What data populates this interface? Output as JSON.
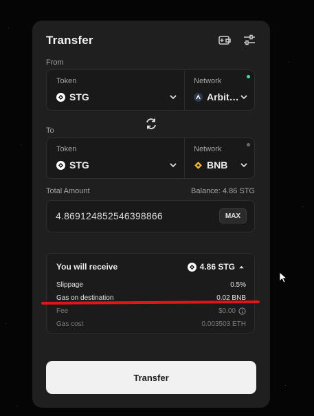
{
  "header": {
    "title": "Transfer",
    "icons": [
      "add-wallet-icon",
      "settings-sliders-icon"
    ]
  },
  "from": {
    "label": "From",
    "token_caption": "Token",
    "token": "STG",
    "network_caption": "Network",
    "network": "Arbit…",
    "status_color": "#4fd1b5"
  },
  "to": {
    "label": "To",
    "token_caption": "Token",
    "token": "STG",
    "network_caption": "Network",
    "network": "BNB",
    "status_color": "#6b6b6b"
  },
  "amount": {
    "label": "Total Amount",
    "balance": "Balance: 4.86 STG",
    "value": "4.869124852546398866",
    "max_label": "MAX"
  },
  "receive": {
    "title": "You will receive",
    "amount": "4.86 STG",
    "rows": [
      {
        "label": "Slippage",
        "value": "0.5%"
      },
      {
        "label": "Gas on destination",
        "value": "0.02 BNB"
      },
      {
        "label": "Fee",
        "value": "$0.00"
      },
      {
        "label": "Gas cost",
        "value": "0.003503 ETH"
      }
    ]
  },
  "transfer_button": "Transfer",
  "colors": {
    "annotation_line": "#e0151b",
    "card": "#1f1f1f",
    "button": "#f1f1f1"
  }
}
